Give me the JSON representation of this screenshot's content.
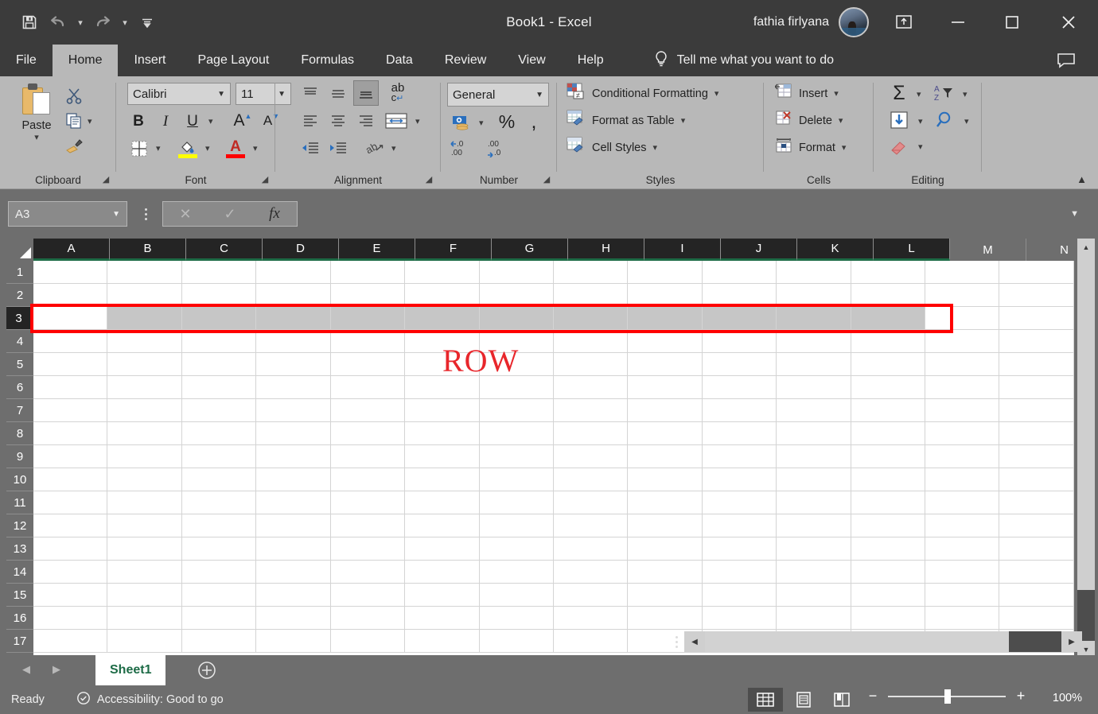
{
  "window": {
    "title": "Book1  -  Excel",
    "user_name": "fathia firlyana",
    "qat": [
      {
        "name": "save",
        "icon": "save-icon"
      },
      {
        "name": "undo",
        "icon": "undo-icon"
      },
      {
        "name": "redo",
        "icon": "redo-icon"
      },
      {
        "name": "customize",
        "icon": "customize-qat-icon"
      }
    ],
    "controls": {
      "ribbon_display": "ribbon-display-options",
      "minimize": "minimize",
      "maximize": "maximize",
      "close": "close"
    }
  },
  "tabs": [
    {
      "label": "File",
      "active": false
    },
    {
      "label": "Home",
      "active": true
    },
    {
      "label": "Insert",
      "active": false
    },
    {
      "label": "Page Layout",
      "active": false
    },
    {
      "label": "Formulas",
      "active": false
    },
    {
      "label": "Data",
      "active": false
    },
    {
      "label": "Review",
      "active": false
    },
    {
      "label": "View",
      "active": false
    },
    {
      "label": "Help",
      "active": false
    }
  ],
  "tell_me": "Tell me what you want to do",
  "ribbon": {
    "groups": {
      "clipboard": {
        "label": "Clipboard",
        "paste": "Paste",
        "cut": "Cut",
        "copy": "Copy",
        "format_painter": "Format Painter"
      },
      "font": {
        "label": "Font",
        "font_name": "Calibri",
        "font_size": "11",
        "bold": "B",
        "italic": "I",
        "underline": "U",
        "increase_size": "A",
        "decrease_size": "A",
        "borders": "Borders",
        "fill_color": "Fill Color",
        "font_color": "Font Color",
        "fill_swatch": "#ffff00",
        "font_swatch": "#ff0000"
      },
      "alignment": {
        "label": "Alignment",
        "top_align": "Top Align",
        "middle_align": "Middle Align",
        "bottom_align": "Bottom Align",
        "wrap_text": "Wrap Text",
        "align_left": "Align Left",
        "center": "Center",
        "align_right": "Align Right",
        "merge_center": "Merge & Center",
        "decrease_indent": "Decrease Indent",
        "increase_indent": "Increase Indent",
        "orientation": "Orientation"
      },
      "number": {
        "label": "Number",
        "format": "General",
        "accounting": "Accounting Number Format",
        "percent": "%",
        "comma": ",",
        "increase_decimal": "Increase Decimal",
        "decrease_decimal": "Decrease Decimal"
      },
      "styles": {
        "label": "Styles",
        "items": [
          {
            "label": "Conditional Formatting",
            "icon": "conditional-formatting-icon"
          },
          {
            "label": "Format as Table",
            "icon": "format-as-table-icon"
          },
          {
            "label": "Cell Styles",
            "icon": "cell-styles-icon"
          }
        ]
      },
      "cells": {
        "label": "Cells",
        "items": [
          {
            "label": "Insert",
            "icon": "insert-cells-icon"
          },
          {
            "label": "Delete",
            "icon": "delete-cells-icon"
          },
          {
            "label": "Format",
            "icon": "format-cells-icon"
          }
        ]
      },
      "editing": {
        "label": "Editing",
        "autosum": "Σ",
        "sort_filter": "Sort & Filter",
        "fill": "Fill",
        "find_select": "Find & Select",
        "clear": "Clear"
      }
    }
  },
  "formula_bar": {
    "name_box": "A3",
    "cancel": "✕",
    "enter": "✓",
    "insert_function": "fx",
    "formula_value": ""
  },
  "sheet": {
    "columns": [
      "A",
      "B",
      "C",
      "D",
      "E",
      "F",
      "G",
      "H",
      "I",
      "J",
      "K",
      "L",
      "M",
      "N"
    ],
    "selected_columns": [
      "A",
      "B",
      "C",
      "D",
      "E",
      "F",
      "G",
      "H",
      "I",
      "J",
      "K",
      "L"
    ],
    "rows": [
      "1",
      "2",
      "3",
      "4",
      "5",
      "6",
      "7",
      "8",
      "9",
      "10",
      "11",
      "12",
      "13",
      "14",
      "15",
      "16",
      "17"
    ],
    "selected_row": "3",
    "active_cell": "A3",
    "cell_values": []
  },
  "annotations": [
    {
      "type": "rectangle",
      "name": "row-highlight-rectangle",
      "color": "#ff0000"
    },
    {
      "type": "text",
      "name": "row-annotation-label",
      "text": "ROW",
      "color": "#e8262b"
    }
  ],
  "sheet_tabs": {
    "prev": "◀",
    "next": "▶",
    "tabs": [
      {
        "label": "Sheet1",
        "active": true
      }
    ],
    "add": "+"
  },
  "status_bar": {
    "status": "Ready",
    "accessibility": "Accessibility: Good to go",
    "views": [
      {
        "name": "normal-view",
        "active": true
      },
      {
        "name": "page-layout-view",
        "active": false
      },
      {
        "name": "page-break-preview",
        "active": false
      }
    ],
    "zoom_out": "−",
    "zoom_in": "+",
    "zoom_level": "100%"
  }
}
